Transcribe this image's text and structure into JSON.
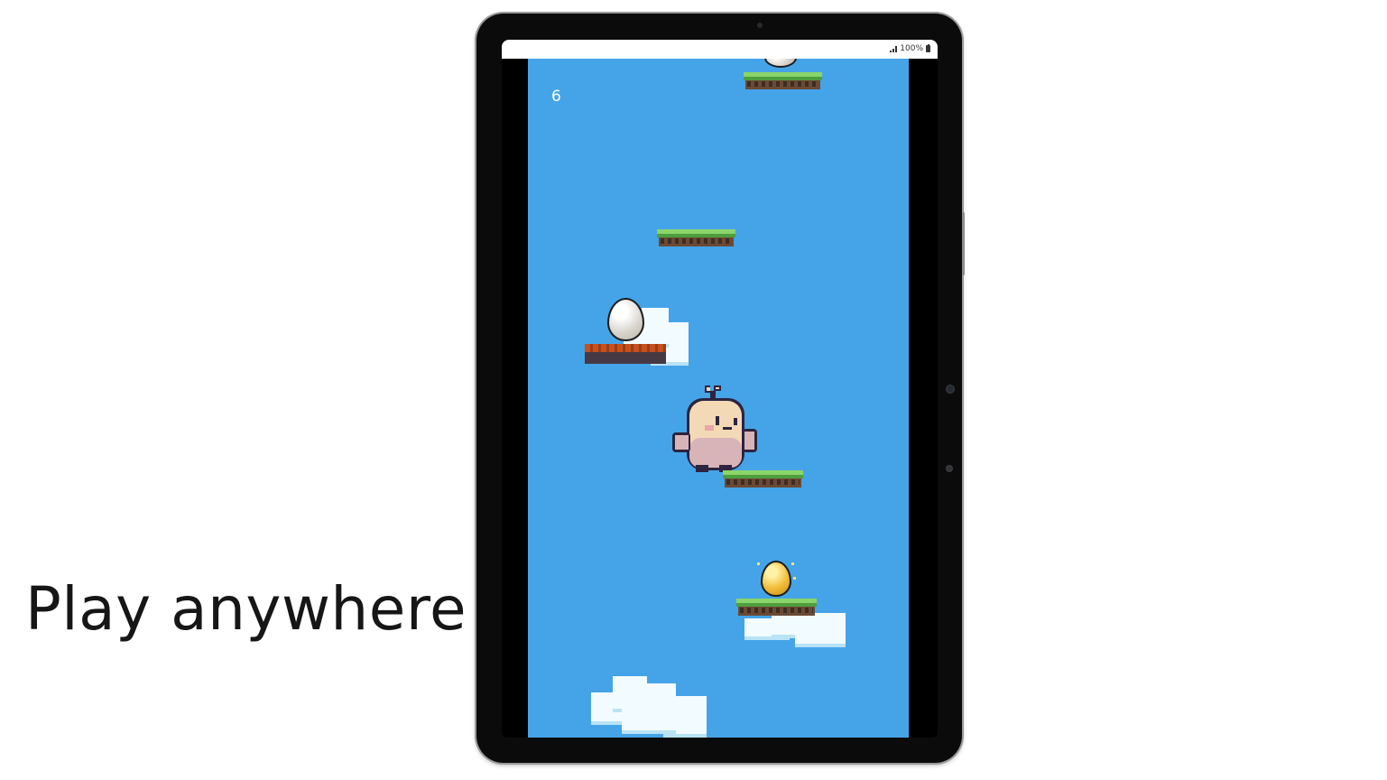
{
  "tagline": "Play anywhere",
  "status_bar": {
    "battery_text": "100%"
  },
  "game": {
    "score": "6"
  },
  "icons": {
    "signal": "signal-icon",
    "battery": "battery-icon",
    "player": "chick-character-icon",
    "egg": "egg-icon",
    "golden_egg": "golden-egg-icon"
  },
  "colors": {
    "sky": "#45a4e8",
    "grass": "#8bd46a",
    "brick": "#c4511f",
    "text": "#161616"
  }
}
